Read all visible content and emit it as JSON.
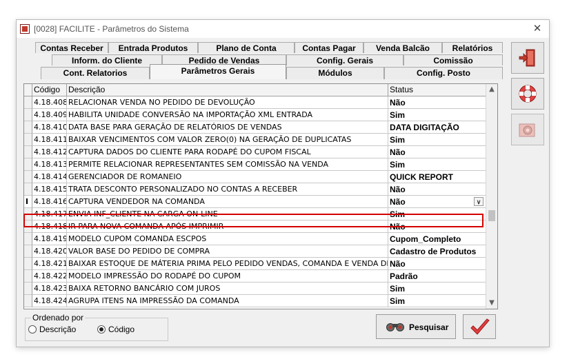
{
  "window": {
    "title": "[0028] FACILITE - Parâmetros do Sistema"
  },
  "tabs": {
    "row1": [
      "Contas Receber",
      "Entrada Produtos",
      "Plano de Conta",
      "Contas Pagar",
      "Venda Balcão",
      "Relatórios"
    ],
    "row2": [
      "Inform. do Cliente",
      "Pedido de Vendas",
      "Config. Gerais",
      "Comissão"
    ],
    "row3": [
      "Cont. Relatorios",
      "Parâmetros Gerais",
      "Módulos",
      "Config. Posto"
    ],
    "active": "Parâmetros Gerais"
  },
  "grid": {
    "headers": {
      "code": "Código",
      "description": "Descrição",
      "status": "Status"
    },
    "rows": [
      {
        "code": "4.18.408",
        "description": "RELACIONAR VENDA NO PEDIDO DE DEVOLUÇÃO",
        "status": "Não"
      },
      {
        "code": "4.18.409",
        "description": "HABILITA UNIDADE CONVERSÃO NA IMPORTAÇÃO XML ENTRADA",
        "status": "Sim"
      },
      {
        "code": "4.18.410",
        "description": "DATA BASE PARA GERAÇÃO DE RELATÓRIOS DE VENDAS",
        "status": "DATA DIGITAÇÃO"
      },
      {
        "code": "4.18.411",
        "description": "BAIXAR VENCIMENTOS COM VALOR ZERO(0) NA GERAÇÃO DE DUPLICATAS",
        "status": "Sim"
      },
      {
        "code": "4.18.412",
        "description": "CAPTURA DADOS DO CLIENTE PARA RODAPÉ DO CUPOM FISCAL",
        "status": "Não"
      },
      {
        "code": "4.18.413",
        "description": "PERMITE RELACIONAR REPRESENTANTES SEM COMISSÃO NA VENDA",
        "status": "Sim"
      },
      {
        "code": "4.18.414",
        "description": "GERENCIADOR DE ROMANEIO",
        "status": "QUICK REPORT"
      },
      {
        "code": "4.18.415",
        "description": "TRATA DESCONTO PERSONALIZADO NO CONTAS A RECEBER",
        "status": "Não"
      },
      {
        "code": "4.18.416",
        "description": "CAPTURA VENDEDOR NA COMANDA",
        "status": "Não"
      },
      {
        "code": "4.18.417",
        "description": "ENVIA INF_CLIENTE NA CARGA ON-LINE",
        "status": "Sim"
      },
      {
        "code": "4.18.418",
        "description": "IR PARA NOVA COMANDA APÓS IMPRIMIR",
        "status": "Não"
      },
      {
        "code": "4.18.419",
        "description": "MODELO CUPOM COMANDA ESCPOS",
        "status": "Cupom_Completo"
      },
      {
        "code": "4.18.420",
        "description": "VALOR BASE DO PEDIDO DE COMPRA",
        "status": "Cadastro de Produtos"
      },
      {
        "code": "4.18.421",
        "description": "BAIXAR ESTOQUE DE MÁTERIA PRIMA PELO PEDIDO VENDAS, COMANDA E VENDA DE KI",
        "status": "Não"
      },
      {
        "code": "4.18.422",
        "description": "MODELO IMPRESSÃO DO RODAPÉ DO CUPOM",
        "status": "Padrão"
      },
      {
        "code": "4.18.423",
        "description": "BAIXA RETORNO BANCÁRIO COM JUROS",
        "status": "Sim"
      },
      {
        "code": "4.18.424",
        "description": "AGRUPA ITENS NA IMPRESSÃO DA COMANDA",
        "status": "Sim"
      }
    ],
    "selected_row_marker": "I",
    "selected_code": "4.18.416"
  },
  "order": {
    "label": "Ordenado por",
    "options": [
      "Descrição",
      "Código"
    ],
    "selected": "Código"
  },
  "buttons": {
    "search_label": "Pesquisar"
  },
  "colors": {
    "selection_outline": "#d40000",
    "exit_icon": "#c0392b"
  }
}
